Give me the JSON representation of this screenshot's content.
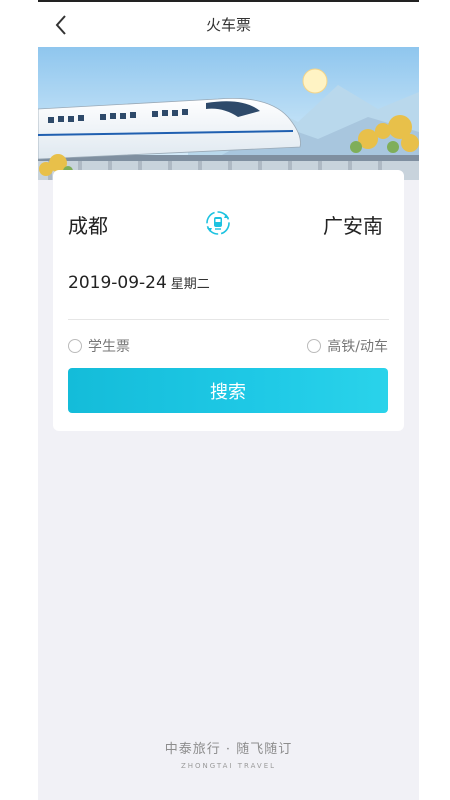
{
  "header": {
    "title": "火车票",
    "back_icon": "chevron-left-icon"
  },
  "route": {
    "from": "成都",
    "to": "广安南",
    "swap_icon": "train-swap-icon"
  },
  "date": {
    "value": "2019-09-24",
    "weekday": "星期二"
  },
  "options": [
    {
      "label": "学生票",
      "checked": false
    },
    {
      "label": "高铁/动车",
      "checked": false
    }
  ],
  "search_button": {
    "label": "搜索"
  },
  "footer": {
    "brand": "中泰旅行 · 随飞随订",
    "brand_en": "ZHONGTAI TRAVEL"
  },
  "colors": {
    "accent": "#1fc9e6",
    "background": "#f1f1f6"
  }
}
